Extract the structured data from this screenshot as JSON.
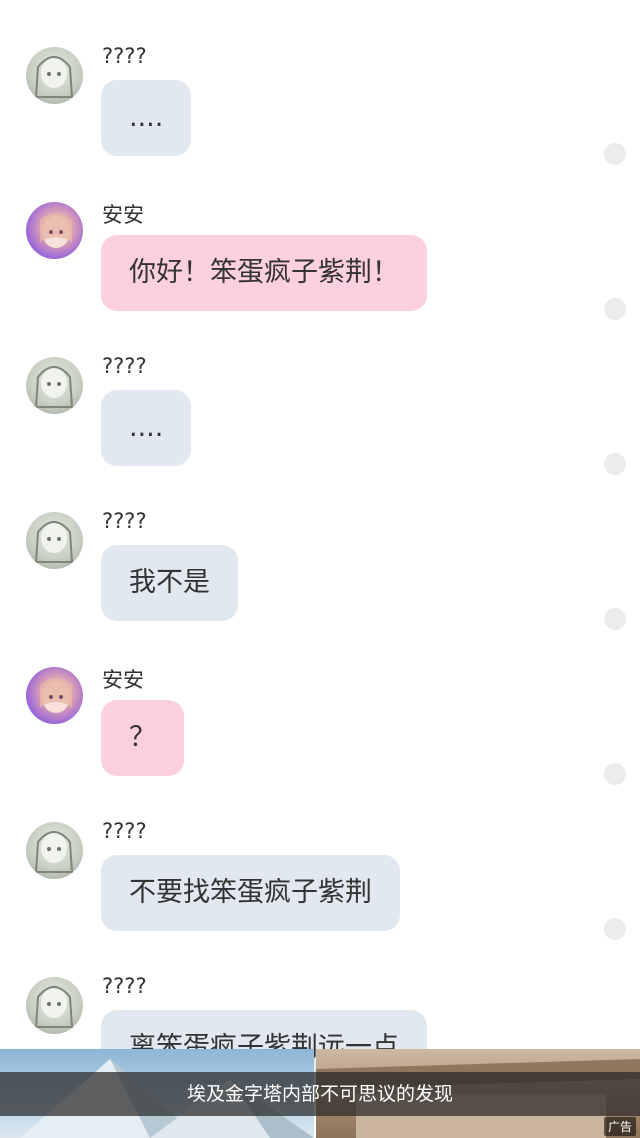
{
  "messages": [
    {
      "sender": "????",
      "text": "....",
      "type": "gray"
    },
    {
      "sender": "安安",
      "text": "你好！笨蛋疯子紫荆！",
      "type": "pink"
    },
    {
      "sender": "????",
      "text": "....",
      "type": "gray"
    },
    {
      "sender": "????",
      "text": "我不是",
      "type": "gray"
    },
    {
      "sender": "安安",
      "text": "？",
      "type": "pink"
    },
    {
      "sender": "????",
      "text": "不要找笨蛋疯子紫荆",
      "type": "gray"
    },
    {
      "sender": "????",
      "text": "离笨蛋疯子紫荆远一点",
      "type": "gray"
    }
  ],
  "ad": {
    "caption": "埃及金字塔内部不可思议的发现",
    "label": "广告"
  },
  "colors": {
    "gray_bubble": "#e1e8ef",
    "pink_bubble": "#fdd0dd"
  }
}
